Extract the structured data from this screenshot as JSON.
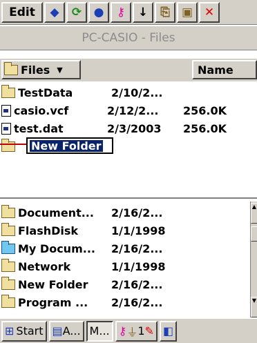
{
  "toolbar": {
    "edit_label": "Edit",
    "icons": [
      "back-icon",
      "refresh-icon",
      "globe-icon",
      "key-icon",
      "down-arrow-icon",
      "copy-icon",
      "paste-icon",
      "delete-icon"
    ]
  },
  "title": "PC-CASIO - Files",
  "header": {
    "files_label": "Files",
    "name_label": "Name"
  },
  "files": [
    {
      "name": "TestData",
      "date": "2/10/2...",
      "size": "",
      "icon": "folder-icon"
    },
    {
      "name": "casio.vcf",
      "date": "2/12/2...",
      "size": "256.0K",
      "icon": "file-icon"
    },
    {
      "name": "test.dat",
      "date": "2/3/2003",
      "size": "256.0K",
      "icon": "file-icon"
    }
  ],
  "rename": {
    "value": "New Folder"
  },
  "folders": [
    {
      "name": "Document...",
      "date": "2/16/2..."
    },
    {
      "name": "FlashDisk",
      "date": "1/1/1998"
    },
    {
      "name": "My Docum...",
      "date": "2/16/2..."
    },
    {
      "name": "Network",
      "date": "1/1/1998"
    },
    {
      "name": "New Folder",
      "date": "2/16/2..."
    },
    {
      "name": "Program ...",
      "date": "2/16/2..."
    }
  ],
  "taskbar": {
    "start_label": "Start",
    "task1": "A...",
    "task2": "M...",
    "clock": "1"
  },
  "colors": {
    "selection": "#0a246a",
    "chrome": "#d4d0c8",
    "arrow": "#c00000"
  }
}
